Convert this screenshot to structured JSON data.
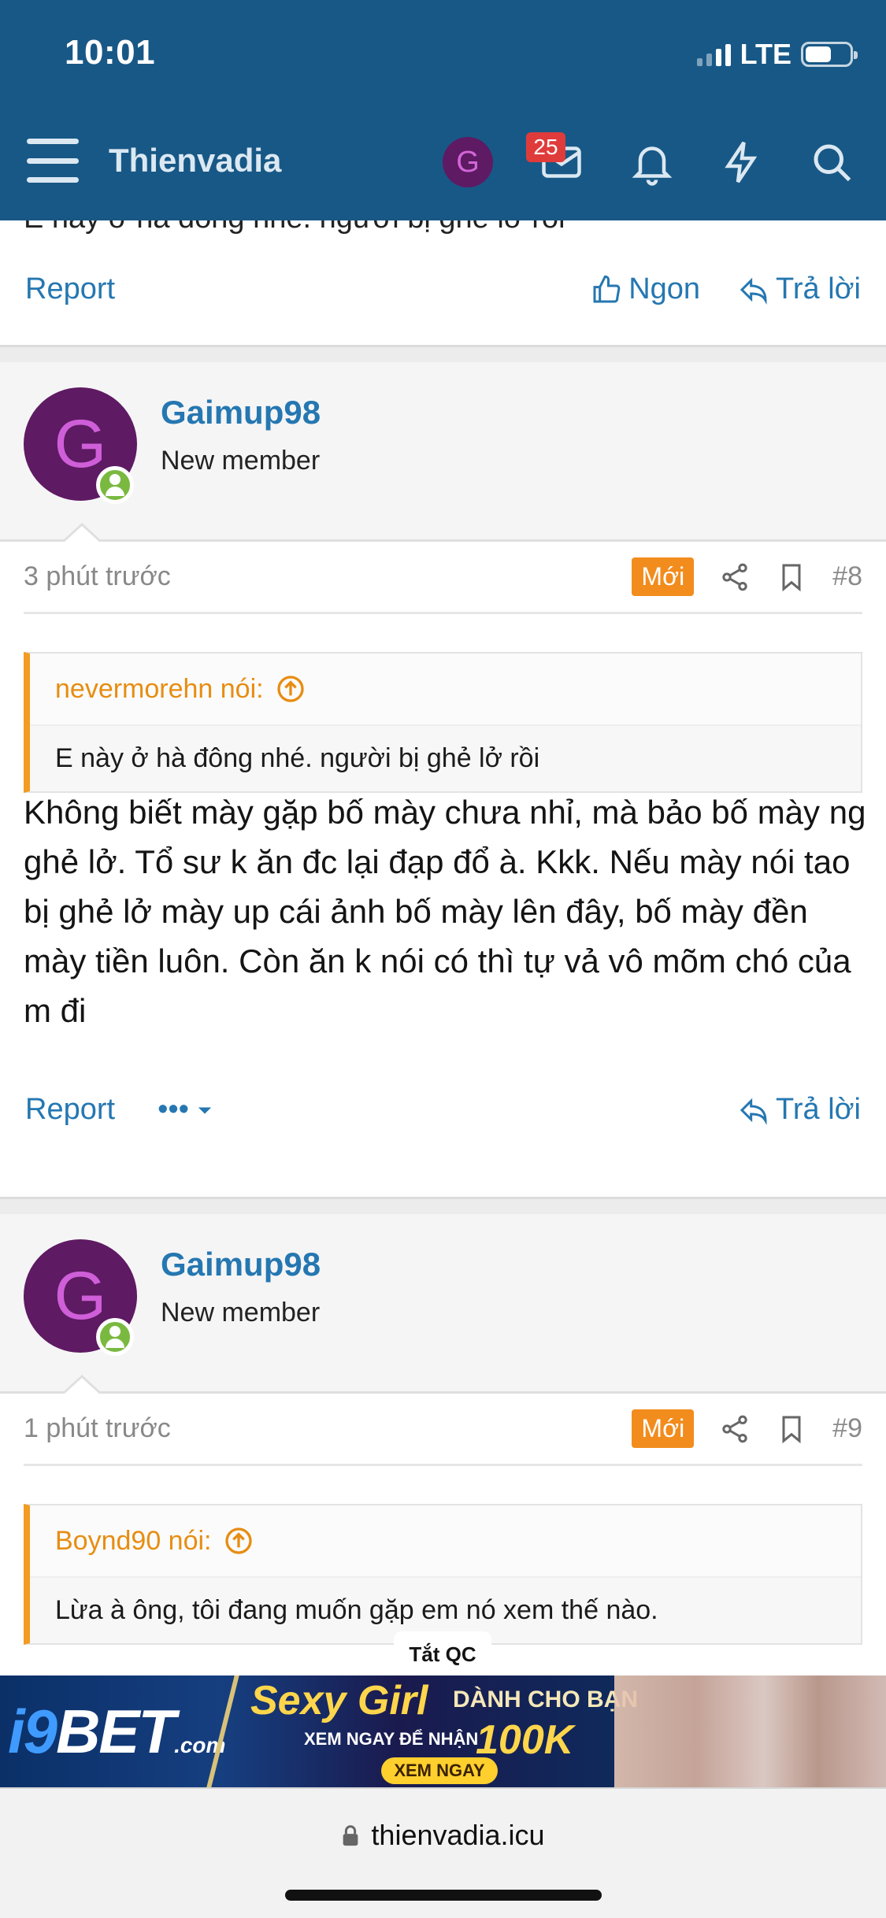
{
  "status": {
    "time": "10:01",
    "network": "LTE"
  },
  "header": {
    "title": "Thienvadia",
    "avatar_letter": "G",
    "inbox_badge": "25"
  },
  "prev_post": {
    "cut_text": "E này ở hà đông nhé. người bị ghẻ lở rồi",
    "report": "Report",
    "like": "Ngon",
    "reply": "Trả lời"
  },
  "posts": [
    {
      "user": {
        "letter": "G",
        "name": "Gaimup98",
        "title": "New member"
      },
      "time": "3 phút trước",
      "badge": "Mới",
      "number": "#8",
      "quote": {
        "author": "nevermorehn nói:",
        "text": "E này ở hà đông nhé. người bị ghẻ lở rồi"
      },
      "message": "Không biết mày gặp bố mày chưa nhỉ, mà bảo bố mày ng ghẻ lở. Tổ sư k ăn đc lại đạp đổ à. Kkk. Nếu mày nói tao bị ghẻ lở mày up cái ảnh bố mày lên đây, bố mày đền mày tiền luôn. Còn ăn k nói có thì tự vả vô mõm chó của m đi",
      "report": "Report",
      "more": "•••",
      "reply": "Trả lời"
    },
    {
      "user": {
        "letter": "G",
        "name": "Gaimup98",
        "title": "New member"
      },
      "time": "1 phút trước",
      "badge": "Mới",
      "number": "#9",
      "quote": {
        "author": "Boynd90 nói:",
        "text": "Lừa à ông, tôi đang muốn gặp em nó xem thế nào."
      }
    }
  ],
  "ad": {
    "label": "Tắt QC",
    "brand_i9": "i9",
    "brand_bet": "BET",
    "brand_com": ".com",
    "headline": "Sexy Girl",
    "subhead": "DÀNH CHO BẠN",
    "line": "XEM NGAY ĐỂ NHẬN",
    "amount": "100K",
    "cta": "XEM NGAY"
  },
  "browser": {
    "url": "thienvadia.icu"
  },
  "colors": {
    "header": "#185886",
    "link": "#2577b1",
    "accent": "#f28c1d",
    "quote_border": "#f29c23",
    "avatar_bg": "#5e1a63"
  }
}
